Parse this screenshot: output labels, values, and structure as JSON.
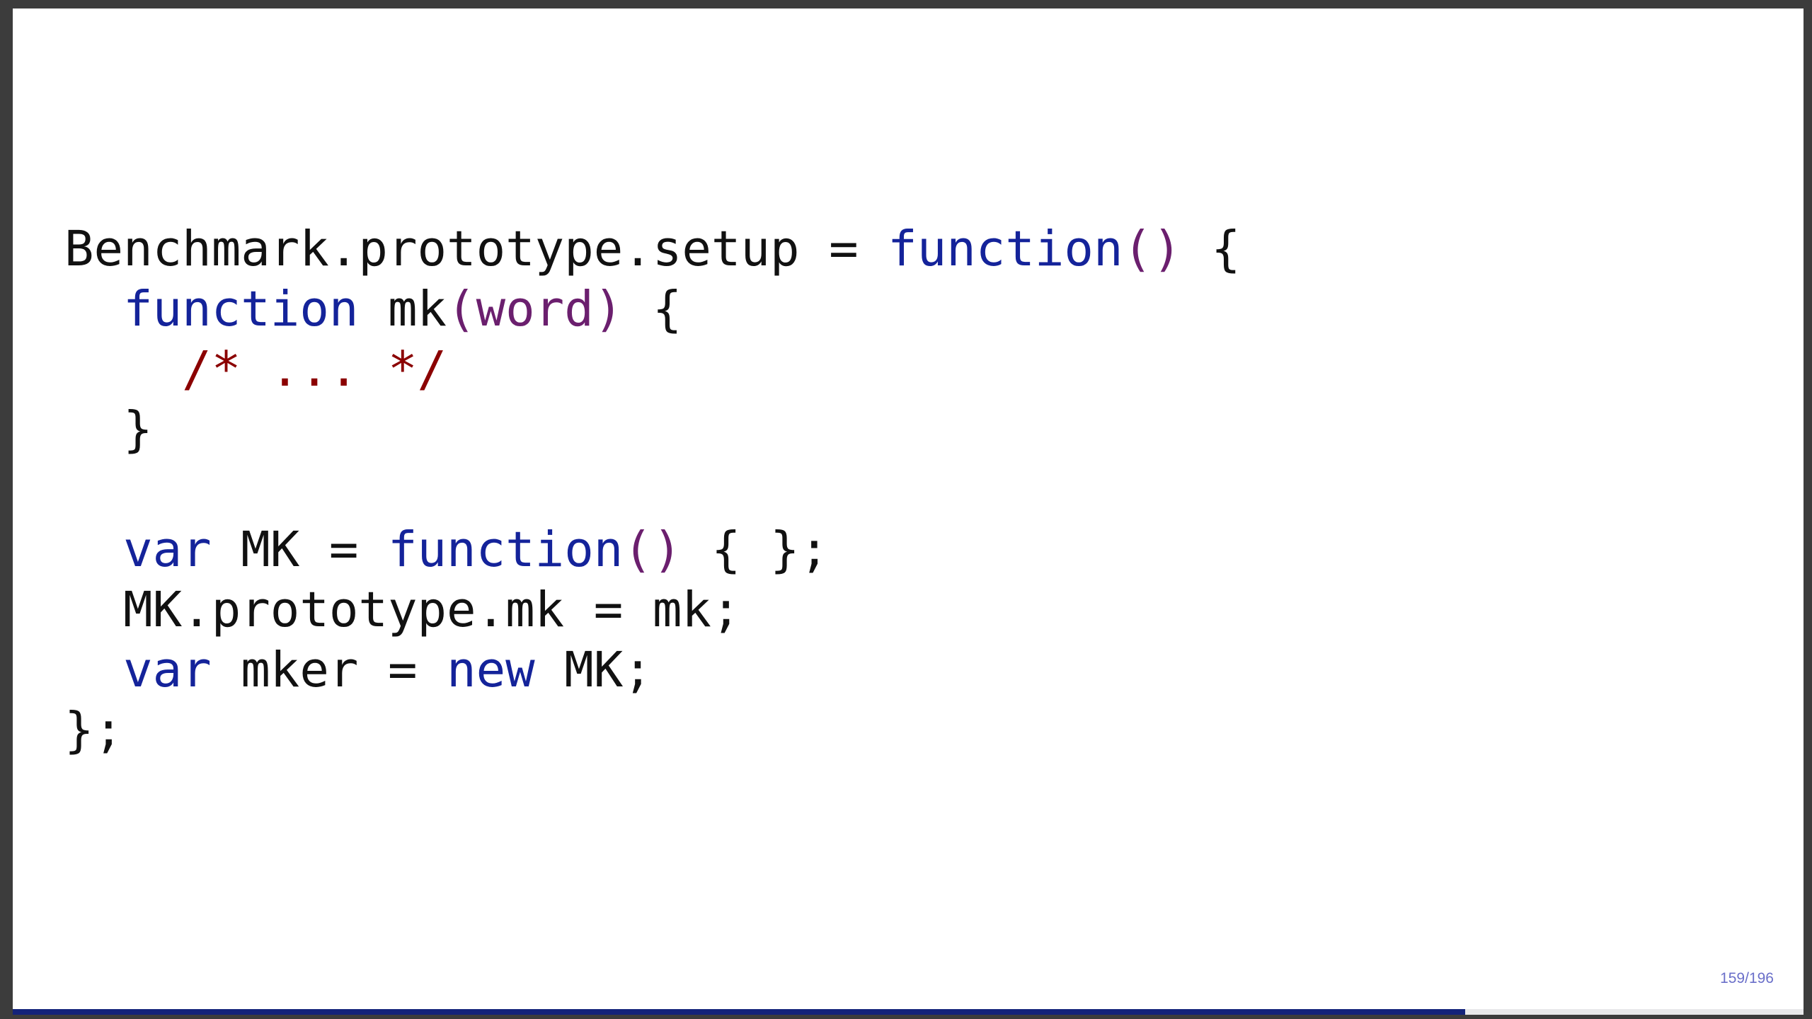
{
  "slide": {
    "code_lines": [
      [
        {
          "type": "plain",
          "text": "Benchmark.prototype.setup = "
        },
        {
          "type": "kw",
          "text": "function"
        },
        {
          "type": "paren",
          "text": "()"
        },
        {
          "type": "plain",
          "text": " {"
        }
      ],
      [
        {
          "type": "plain",
          "text": "  "
        },
        {
          "type": "kw",
          "text": "function"
        },
        {
          "type": "plain",
          "text": " mk"
        },
        {
          "type": "paren",
          "text": "(word)"
        },
        {
          "type": "plain",
          "text": " {"
        }
      ],
      [
        {
          "type": "plain",
          "text": "    "
        },
        {
          "type": "comment",
          "text": "/* ... */"
        }
      ],
      [
        {
          "type": "plain",
          "text": "  }"
        }
      ],
      [
        {
          "type": "plain",
          "text": ""
        }
      ],
      [
        {
          "type": "plain",
          "text": "  "
        },
        {
          "type": "kw",
          "text": "var"
        },
        {
          "type": "plain",
          "text": " MK = "
        },
        {
          "type": "kw",
          "text": "function"
        },
        {
          "type": "paren",
          "text": "()"
        },
        {
          "type": "plain",
          "text": " { };"
        }
      ],
      [
        {
          "type": "plain",
          "text": "  MK.prototype.mk = mk;"
        }
      ],
      [
        {
          "type": "plain",
          "text": "  "
        },
        {
          "type": "kw",
          "text": "var"
        },
        {
          "type": "plain",
          "text": " mker = "
        },
        {
          "type": "kw",
          "text": "new"
        },
        {
          "type": "plain",
          "text": " MK;"
        }
      ],
      [
        {
          "type": "plain",
          "text": "};"
        }
      ]
    ]
  },
  "footer": {
    "page_number": "159/196",
    "progress_fraction": 0.811
  },
  "colors": {
    "keyword": "#14239a",
    "paren": "#6b1f6e",
    "comment": "#8b0000",
    "progress": "#14237a"
  }
}
